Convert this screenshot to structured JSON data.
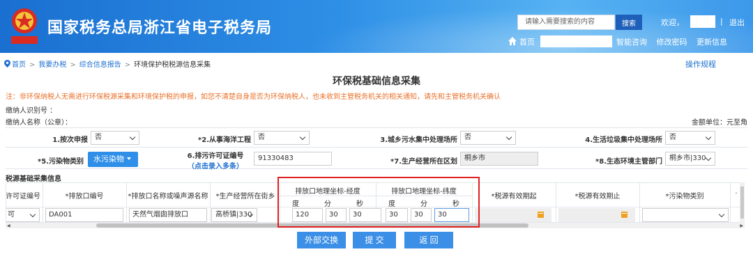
{
  "header": {
    "site_title": "国家税务总局浙江省电子税务局",
    "emblem_text": "中国税务",
    "search_placeholder": "请输入需要搜索的内容",
    "search_button": "搜索",
    "welcome": "欢迎，",
    "separator": "|",
    "logout": "退出",
    "home": "首页",
    "nav": [
      "智能咨询",
      "修改密码",
      "更新信息"
    ]
  },
  "breadcrumb": {
    "items": [
      "首页",
      "我要办税",
      "综合信息报告",
      "环境保护税税源信息采集"
    ],
    "separator": ">"
  },
  "rules_link": "操作规程",
  "page_title": "环保税基础信息采集",
  "notice": "注：非环保纳税人无需进行环保税源采集和环境保护税的申报，如您不清楚自身是否为环保纳税人，也未收到主管税务机关的相关通知，请先和主管税务机关确认",
  "taxpayer": {
    "id_label": "缴纳人识别号 ：",
    "name_label": "缴纳人名称（公章）：",
    "unit_label": "金额单位：元至角"
  },
  "form": {
    "f1_label": "1.按次申报",
    "f1_value": "否",
    "f2_label": "*2.从事海洋工程",
    "f2_value": "否",
    "f3_label": "3.城乡污水集中处理场所",
    "f3_value": "否",
    "f4_label": "4.生活垃圾集中处理场所",
    "f4_value": "否",
    "f5_label": "*5.污染物类别",
    "f5_value": "水污染物",
    "f6_label": "6.排污许可证编号",
    "f6_sub": "（点击录入多条）",
    "f6_value": "91330483",
    "f7_label": "*7.生产经营所在区划",
    "f7_value": "桐乡市",
    "f8_label": "*8.生态环境主管部门",
    "f8_value": "桐乡市|330"
  },
  "section_title": "税源基础采集信息",
  "table": {
    "headers": {
      "permit_no": "许可证编号",
      "outlet_no": "*排放口编号",
      "outlet_name": "*排放口名称或噪声源名称",
      "street": "*生产经营所在街乡",
      "lng_group": "排放口地理坐标-经度",
      "lat_group": "排放口地理坐标-纬度",
      "deg": "度",
      "min": "分",
      "sec": "秒",
      "valid_from": "*税源有效期起",
      "valid_to": "*税源有效期止",
      "pollutant": "*污染物类别",
      "cut": "·"
    },
    "row": {
      "permit": "可",
      "outlet_no": "DA001",
      "outlet_name": "天然气烟囱排放口",
      "street": "高桥镇|330",
      "lng_deg": "120",
      "lng_min": "30",
      "lng_sec": "30",
      "lat_deg": "30",
      "lat_min": "30",
      "lat_sec": "30"
    }
  },
  "buttons": {
    "external": "外部交换",
    "submit": "提 交",
    "back": "返 回"
  },
  "colors": {
    "header_blue": "#2e8fe6",
    "link_blue": "#1e6fd0",
    "notice_orange": "#e8702a",
    "button_blue": "#3b8fe6",
    "highlight_red": "#e02020",
    "calendar_orange": "#f0a020"
  }
}
